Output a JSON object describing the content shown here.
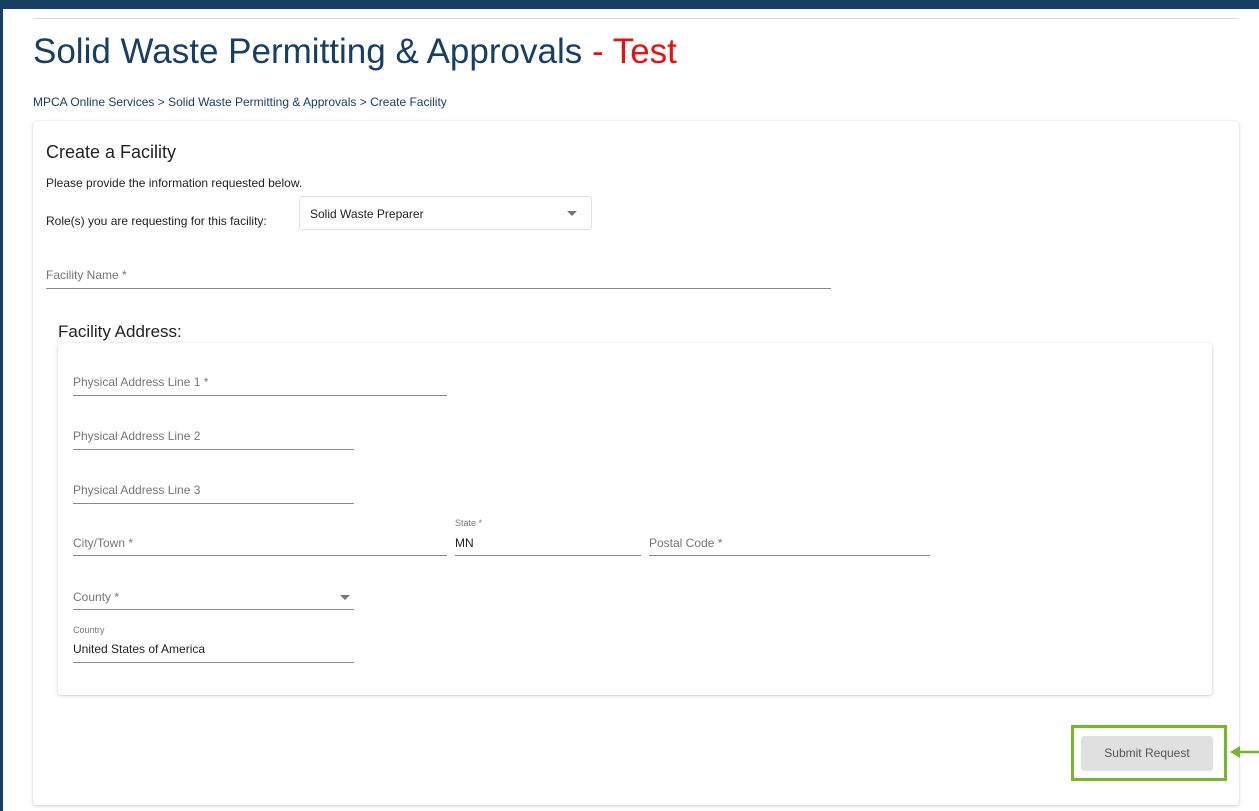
{
  "header": {
    "title": "Solid Waste Permitting & Approvals",
    "title_separator": "-",
    "environment": "Test",
    "title_color": "#173f63",
    "environment_color": "#e81010"
  },
  "breadcrumb": {
    "items": [
      "MPCA Online Services",
      "Solid Waste Permitting & Approvals"
    ],
    "separator": ">",
    "current": "Create Facility"
  },
  "form": {
    "title": "Create a Facility",
    "instructions": "Please provide the information requested below.",
    "role": {
      "label": "Role(s) you are requesting for this facility:",
      "selected": "Solid Waste Preparer",
      "icon": "chevron-down-icon"
    },
    "facility_name": {
      "placeholder": "Facility Name *",
      "value": ""
    },
    "address": {
      "heading": "Facility Address:",
      "line1": {
        "placeholder": "Physical Address Line 1 *",
        "value": ""
      },
      "line2": {
        "placeholder": "Physical Address Line 2",
        "value": ""
      },
      "line3": {
        "placeholder": "Physical Address Line 3",
        "value": ""
      },
      "city": {
        "placeholder": "City/Town *",
        "value": ""
      },
      "state": {
        "label": "State *",
        "value": "MN"
      },
      "postal_code": {
        "placeholder": "Postal Code *",
        "value": ""
      },
      "county": {
        "placeholder": "County *",
        "value": ""
      },
      "country": {
        "label": "Country",
        "value": "United States of America"
      }
    },
    "submit_label": "Submit Request",
    "highlight_color": "#77b82a"
  }
}
